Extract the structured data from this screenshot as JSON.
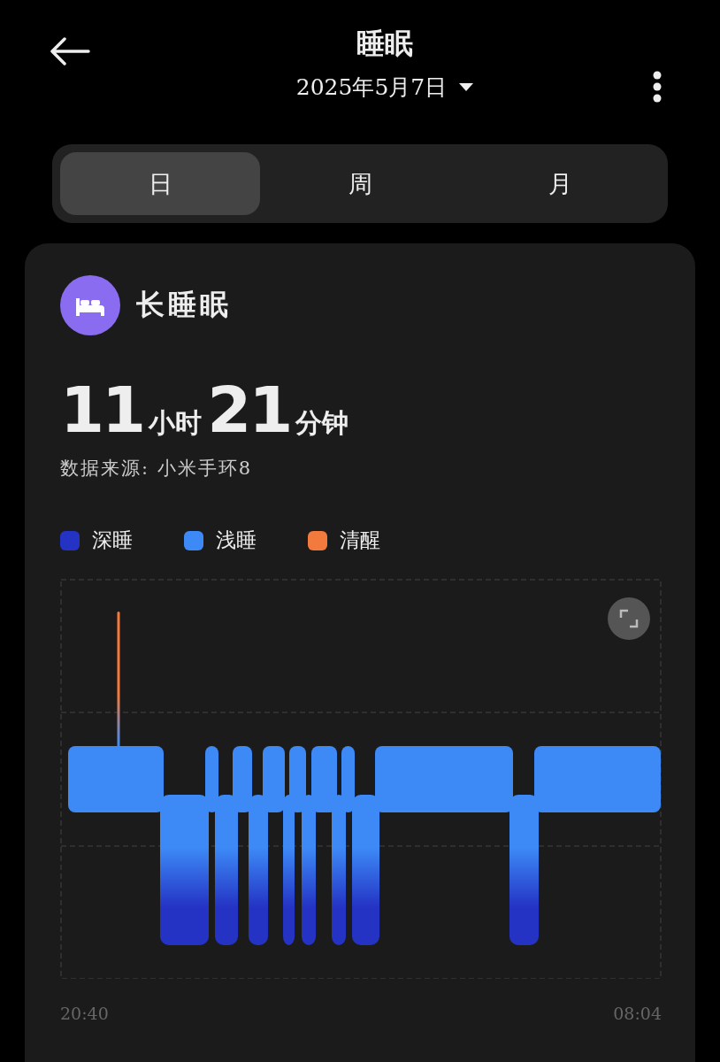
{
  "header": {
    "title": "睡眠",
    "date": "2025年5月7日"
  },
  "tabs": [
    {
      "label": "日",
      "selected": true
    },
    {
      "label": "周",
      "selected": false
    },
    {
      "label": "月",
      "selected": false
    }
  ],
  "card": {
    "title": "长睡眠",
    "duration": [
      {
        "kind": "number",
        "text": "11"
      },
      {
        "kind": "unit",
        "text": "小时"
      },
      {
        "kind": "number",
        "text": "21"
      },
      {
        "kind": "unit",
        "text": "分钟"
      }
    ],
    "source": "数据来源: 小米手环8",
    "legend": [
      {
        "label": "深睡",
        "color": "#2433c4"
      },
      {
        "label": "浅睡",
        "color": "#3d8af7"
      },
      {
        "label": "清醒",
        "color": "#f27a3c"
      }
    ],
    "chart": {
      "start_time": "20:40",
      "end_time": "08:04"
    }
  }
}
